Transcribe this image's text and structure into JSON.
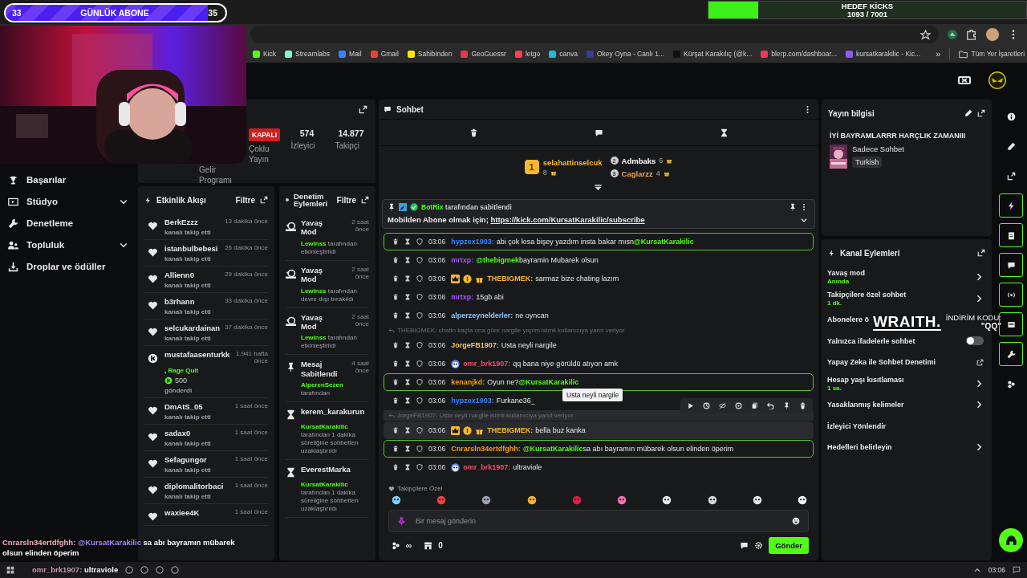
{
  "stream_overlay": {
    "sub_goal": {
      "start": "33",
      "title": "GÜNLÜK ABONE",
      "end": "35",
      "level": 0.92
    },
    "kicks_goal": {
      "title": "HEDEF KİCKS",
      "count": "1093 / 7001",
      "level": 0.156
    },
    "sponsor": {
      "brand": "WRAITH.",
      "label": "İNDİRİM KODU:",
      "code": "\"QQ\""
    },
    "chat_popup": {
      "user": "Cnrarsln34ertdfghh:",
      "mention": "@KursatKarakilic",
      "text": "sa abı bayramın mübarek",
      "text2": "olsun elinden öperim"
    },
    "chat_popup2": {
      "user": "omr_brk1907:",
      "text": "ultraviole"
    }
  },
  "bookmarks": [
    {
      "label": "Kick",
      "color": "#53fc18"
    },
    {
      "label": "Streamlabs",
      "color": "#80f5d2"
    },
    {
      "label": "Mail",
      "color": "#3b82f6"
    },
    {
      "label": "Gmail",
      "color": "#ea4335"
    },
    {
      "label": "Sahibinden",
      "color": "#ffe800"
    },
    {
      "label": "GeoGuessr",
      "color": "#e53950"
    },
    {
      "label": "letgo",
      "color": "#ff3f55"
    },
    {
      "label": "canva",
      "color": "#22b8d6"
    },
    {
      "label": "Okey Oyna - Canlı 1...",
      "color": "#3b3b9b"
    },
    {
      "label": "Kürşat Karakılıç (@k...",
      "color": "#111111"
    },
    {
      "label": "blerp.com/dashboar...",
      "color": "#e8385f"
    },
    {
      "label": "kursatkarakilic - Kic...",
      "color": "#8b5cf6"
    }
  ],
  "bookmarks_more": "»",
  "all_bookmarks": "Tüm Yer İşaretleri",
  "sidebar": {
    "items": [
      {
        "label": "Başarılar",
        "kind": "link"
      },
      {
        "label": "Stüdyo",
        "kind": "group"
      },
      {
        "label": "Denetleme",
        "kind": "link"
      },
      {
        "label": "Topluluk",
        "kind": "group"
      },
      {
        "label": "Droplar ve ödüller",
        "kind": "link"
      }
    ]
  },
  "stream_stats": {
    "status": "KAPALI",
    "multistream": "Çoklu Yayın",
    "revenue": "Gelir Programı",
    "viewers": "574",
    "viewers_label": "İzleyici",
    "followers": "14.877",
    "followers_label": "Takipçi"
  },
  "activity_feed": {
    "title": "Etkinlik Akışı",
    "filter": "Filtre",
    "items": [
      {
        "kind": "follow",
        "user": "BerkEzzz",
        "time": "13 dakika önce",
        "sub": "kanalı takip etti"
      },
      {
        "kind": "follow",
        "user": "istanbulbebesi",
        "time": "26 dakika önce",
        "sub": "kanalı takip etti"
      },
      {
        "kind": "follow",
        "user": "Allienn0",
        "time": "29 dakika önce",
        "sub": "kanalı takip etti"
      },
      {
        "kind": "follow",
        "user": "b3rhann",
        "time": "33 dakika önce",
        "sub": "kanalı takip etti"
      },
      {
        "kind": "follow",
        "user": "selcukardainan",
        "time": "37 dakika önce",
        "sub": "kanalı takip etti"
      },
      {
        "kind": "kicks",
        "user": "mustafaasenturkk",
        "time": "1.941 hafta önce",
        "gift": ", **Rage Quit**",
        "amount": "500",
        "sub": "gönderdi"
      },
      {
        "kind": "follow",
        "user": "DmAtS_05",
        "time": "1 saat önce",
        "sub": "kanalı takip etti"
      },
      {
        "kind": "follow",
        "user": "sadax0",
        "time": "1 saat önce",
        "sub": "kanalı takip etti"
      },
      {
        "kind": "follow",
        "user": "Sefagungor",
        "time": "1 saat önce",
        "sub": "kanalı takip etti"
      },
      {
        "kind": "follow",
        "user": "diplomalitorbaci",
        "time": "1 saat önce",
        "sub": "kanalı takip etti"
      },
      {
        "kind": "follow",
        "user": "waxiee4K",
        "time": "1 saat önce"
      }
    ]
  },
  "mod_actions": {
    "title": "Denetim Eylemleri",
    "filter": "Filtre",
    "items": [
      {
        "kind": "slow",
        "title": "Yavaş Mod",
        "time": "2 saat önce",
        "actor": "Lewinss",
        "text": "tarafından etkinleştirildi"
      },
      {
        "kind": "slow",
        "title": "Yavaş Mod",
        "time": "2 saat önce",
        "actor": "Lewinss",
        "text": "tarafından devre dışı bırakıldı"
      },
      {
        "kind": "slow",
        "title": "Yavaş Mod",
        "time": "2 saat önce",
        "actor": "Lewinss",
        "text": "tarafından etkinleştirildi"
      },
      {
        "kind": "pin",
        "title": "Mesaj Sabitlendi",
        "time": "4 saat önce",
        "actor": "AlperenSezen",
        "text": "tarafından"
      },
      {
        "kind": "timeout",
        "title": "kerem_karakurun",
        "actor": "KursatKarakilic",
        "text": "tarafından 1 dakika süreliğine sohbetten uzaklaştırıldı"
      },
      {
        "kind": "timeout",
        "title": "EverestMarka",
        "actor": "KursatKarakilic",
        "text": "tarafından 1 dakika süreliğine sohbetten uzaklaştırıldı"
      }
    ]
  },
  "chat": {
    "title": "Sohbet",
    "top_gifters": [
      {
        "rank": "1",
        "user": "selahattinselcuk",
        "count": "8",
        "color": "#f5b82e"
      },
      {
        "rank": "2",
        "user": "Admbaks",
        "count": "6",
        "color": "#ffffff"
      },
      {
        "rank": "3",
        "user": "Caglarzz",
        "count": "4",
        "color": "#f0a04b"
      }
    ],
    "pinned": {
      "author": "BotRix",
      "label": "tarafından sabitlendi",
      "text": "Mobilden Abone olmak için;",
      "link": "https://kick.com/KursatKarakilic/subscribe"
    },
    "messages": [
      {
        "kind": "message",
        "time": "03:06",
        "user": "hypzex1903:",
        "color": "#3b82f6",
        "text": "abi çok kısa bişey yazdım insta bakar mısn",
        "mention": "@KursatKarakilic",
        "mention_first": false,
        "highlighted": true,
        "hovered": false
      },
      {
        "kind": "message",
        "time": "03:06",
        "user": "mrtxp:",
        "color": "#a855f7",
        "text": "bayramin Mubarek olsun",
        "mention": "@thebigmek",
        "mention_first": true,
        "highlighted": false,
        "hovered": false
      },
      {
        "kind": "message",
        "time": "03:06",
        "user": "THEBIGMEK:",
        "color": "#f5b82e",
        "badges": [
          {
            "kind": "crown"
          },
          {
            "kind": "rank"
          },
          {
            "kind": "gift"
          }
        ],
        "text": "sarmaz bize chating lazım",
        "highlighted": false,
        "hovered": false
      },
      {
        "kind": "message",
        "time": "03:06",
        "user": "mrtxp:",
        "color": "#a855f7",
        "text": "15gb abi",
        "highlighted": false,
        "hovered": false
      },
      {
        "kind": "message",
        "time": "03:06",
        "user": "alperzeynelderler:",
        "color": "#93c5fd",
        "text": "ne oyncan",
        "highlighted": false,
        "hovered": false
      },
      {
        "kind": "reply",
        "text": "THEBIGMEK: chatin kaçta ona göre nargile yapim isimli kullanıcıya yanıt veriyor"
      },
      {
        "kind": "message",
        "time": "03:06",
        "user": "JorgeFB1907:",
        "color": "#f5c26b",
        "text": "Usta neyli nargile",
        "highlighted": false,
        "hovered": false
      },
      {
        "kind": "message",
        "time": "03:06",
        "user": "omr_brk1907:",
        "color": "#f0506e",
        "badges": [
          {
            "kind": "avatar"
          }
        ],
        "text": "qq bana niye görüldü atıyon amk",
        "highlighted": false,
        "hovered": false
      },
      {
        "kind": "message",
        "time": "03:06",
        "user": "kenanjkd:",
        "color": "#f59e0b",
        "text": "Oyun ne?",
        "mention": "@KursatKarakilic",
        "mention_first": false,
        "highlighted": true,
        "hovered": false
      },
      {
        "kind": "message",
        "time": "03:06",
        "user": "hypzex1903:",
        "color": "#3b82f6",
        "text": "Furkane36_",
        "highlighted": false,
        "hovered": false
      },
      {
        "kind": "reply",
        "text": "JorgeFB1907: Usta neyli nargile isimli kullanıcıya yanıt veriyor"
      },
      {
        "kind": "message",
        "time": "03:06",
        "user": "THEBIGMEK:",
        "color": "#f5b82e",
        "badges": [
          {
            "kind": "crown"
          },
          {
            "kind": "rank"
          },
          {
            "kind": "gift"
          }
        ],
        "text": "bella buz kanka",
        "highlighted": false,
        "hovered": true
      },
      {
        "kind": "message",
        "time": "03:06",
        "user": "Cnrarsln34ertdfghh:",
        "color": "#f59e0b",
        "text": "sa abı bayramın mübarek olsun elinden öperim",
        "mention": "@KursatKarakilic",
        "mention_first": true,
        "highlighted": true,
        "hovered": false
      },
      {
        "kind": "message",
        "time": "03:06",
        "user": "omr_brk1907:",
        "color": "#f0506e",
        "badges": [
          {
            "kind": "avatar"
          }
        ],
        "text": "ultraviole",
        "highlighted": false,
        "hovered": false
      }
    ],
    "tooltip": "Usta neyli nargile",
    "emote_section": "Takipçilere Özel",
    "input_placeholder": "Bir mesaj gönderin",
    "points": "∞",
    "store_count": "0",
    "send": "Gönder"
  },
  "stream_info": {
    "title": "Yayın bilgisi",
    "stream_title": "İYİ BAYRAMLARRR HARÇLIK ZAMANIII",
    "category": "Sadece Sohbet",
    "tag": "Turkish"
  },
  "channel_actions": {
    "title": "Kanal Eylemleri",
    "items": [
      {
        "kind": "arrow",
        "label": "Yavaş mod",
        "sub": "Anında"
      },
      {
        "kind": "arrow",
        "label": "Takipçilere özel sohbet",
        "sub": "1 dk."
      },
      {
        "kind": "plain",
        "label": "Abonelere ö"
      },
      {
        "kind": "toggle",
        "label": "Yalnızca ifadelerle sohbet",
        "on": false
      },
      {
        "kind": "external",
        "label": "Yapay Zeka ile Sohbet Denetimi"
      },
      {
        "kind": "arrow",
        "label": "Hesap yaşı kısıtlaması",
        "sub": "1 sa."
      },
      {
        "kind": "arrow",
        "label": "Yasaklanmış kelimeler"
      },
      {
        "kind": "plain",
        "label": "İzleyici Yönlendir"
      },
      {
        "kind": "arrow",
        "label": "Hedefleri belirleyin"
      }
    ]
  },
  "taskbar": {
    "time": "03:06"
  }
}
